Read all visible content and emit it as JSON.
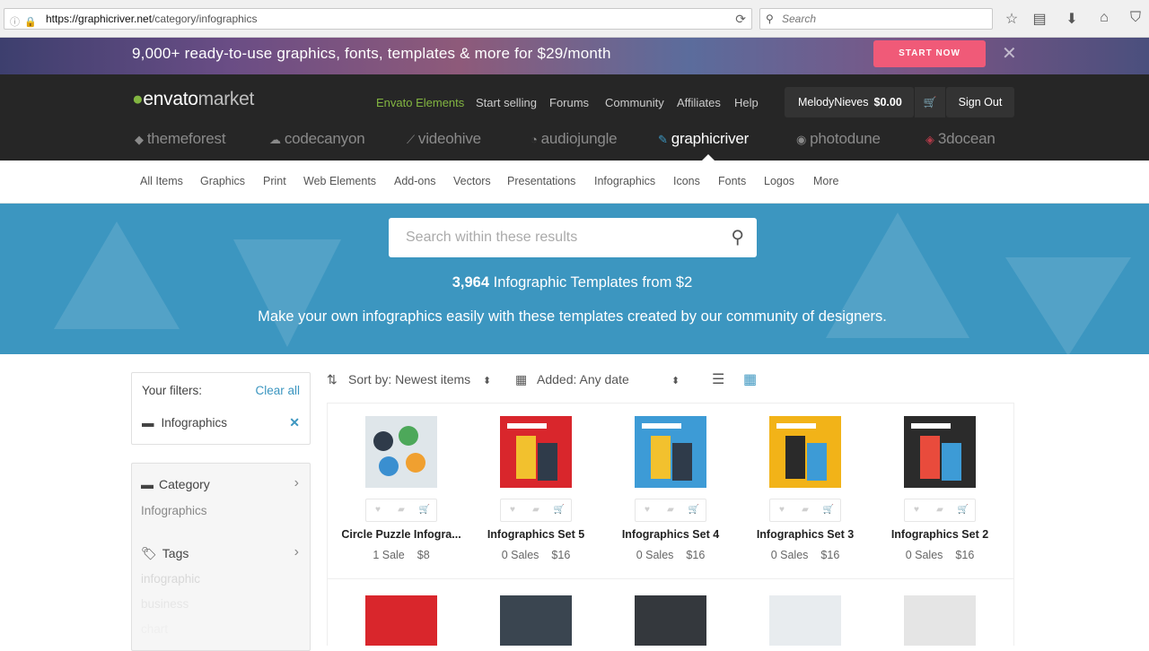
{
  "browser": {
    "url_host": "https://graphicriver.net",
    "url_path": "/category/infographics",
    "search_placeholder": "Search"
  },
  "promo": {
    "text": "9,000+ ready-to-use graphics, fonts, templates & more for $29/month",
    "cta": "START NOW",
    "close": "✕"
  },
  "header": {
    "logo_a": "envato",
    "logo_b": "market",
    "nav": [
      "Envato Elements",
      "Start selling",
      "Forums",
      "Community",
      "Affiliates",
      "Help"
    ],
    "username": "MelodyNieves",
    "balance": "$0.00",
    "sign_out": "Sign Out",
    "markets": [
      "themeforest",
      "codecanyon",
      "videohive",
      "audiojungle",
      "graphicriver",
      "photodune",
      "3docean"
    ],
    "active_market": "graphicriver"
  },
  "categories": [
    "All Items",
    "Graphics",
    "Print",
    "Web Elements",
    "Add-ons",
    "Vectors",
    "Presentations",
    "Infographics",
    "Icons",
    "Fonts",
    "Logos",
    "More"
  ],
  "hero": {
    "search_placeholder": "Search within these results",
    "count": "3,964",
    "count_suffix": " Infographic Templates from $2",
    "tagline": "Make your own infographics easily with these templates created by our community of designers."
  },
  "filters": {
    "label": "Your filters:",
    "clear": "Clear all",
    "active": "Infographics"
  },
  "sidebar": {
    "category_label": "Category",
    "category_value": "Infographics",
    "tags_label": "Tags",
    "tags": [
      "infographic",
      "business",
      "chart"
    ]
  },
  "sort": {
    "sort_label": "Sort by: Newest items",
    "date_label": "Added: Any date"
  },
  "items": [
    {
      "title": "Circle Puzzle Infogra...",
      "sales": "1 Sale",
      "price": "$8",
      "bg": "#dfe6ea",
      "accent": "#2f3b4a"
    },
    {
      "title": "Infographics Set 5",
      "sales": "0 Sales",
      "price": "$16",
      "bg": "#d9262c",
      "accent": "#f2c12e"
    },
    {
      "title": "Infographics Set 4",
      "sales": "0 Sales",
      "price": "$16",
      "bg": "#3d9bd6",
      "accent": "#f2c12e"
    },
    {
      "title": "Infographics Set 3",
      "sales": "0 Sales",
      "price": "$16",
      "bg": "#f2b318",
      "accent": "#2a2a2a"
    },
    {
      "title": "Infographics Set 2",
      "sales": "0 Sales",
      "price": "$16",
      "bg": "#2b2b2b",
      "accent": "#e94b3c"
    }
  ],
  "items_row2": [
    {
      "bg": "#d9262c"
    },
    {
      "bg": "#3a4550"
    },
    {
      "bg": "#34383d"
    },
    {
      "bg": "#e8ecef"
    },
    {
      "bg": "#e5e5e5"
    }
  ]
}
